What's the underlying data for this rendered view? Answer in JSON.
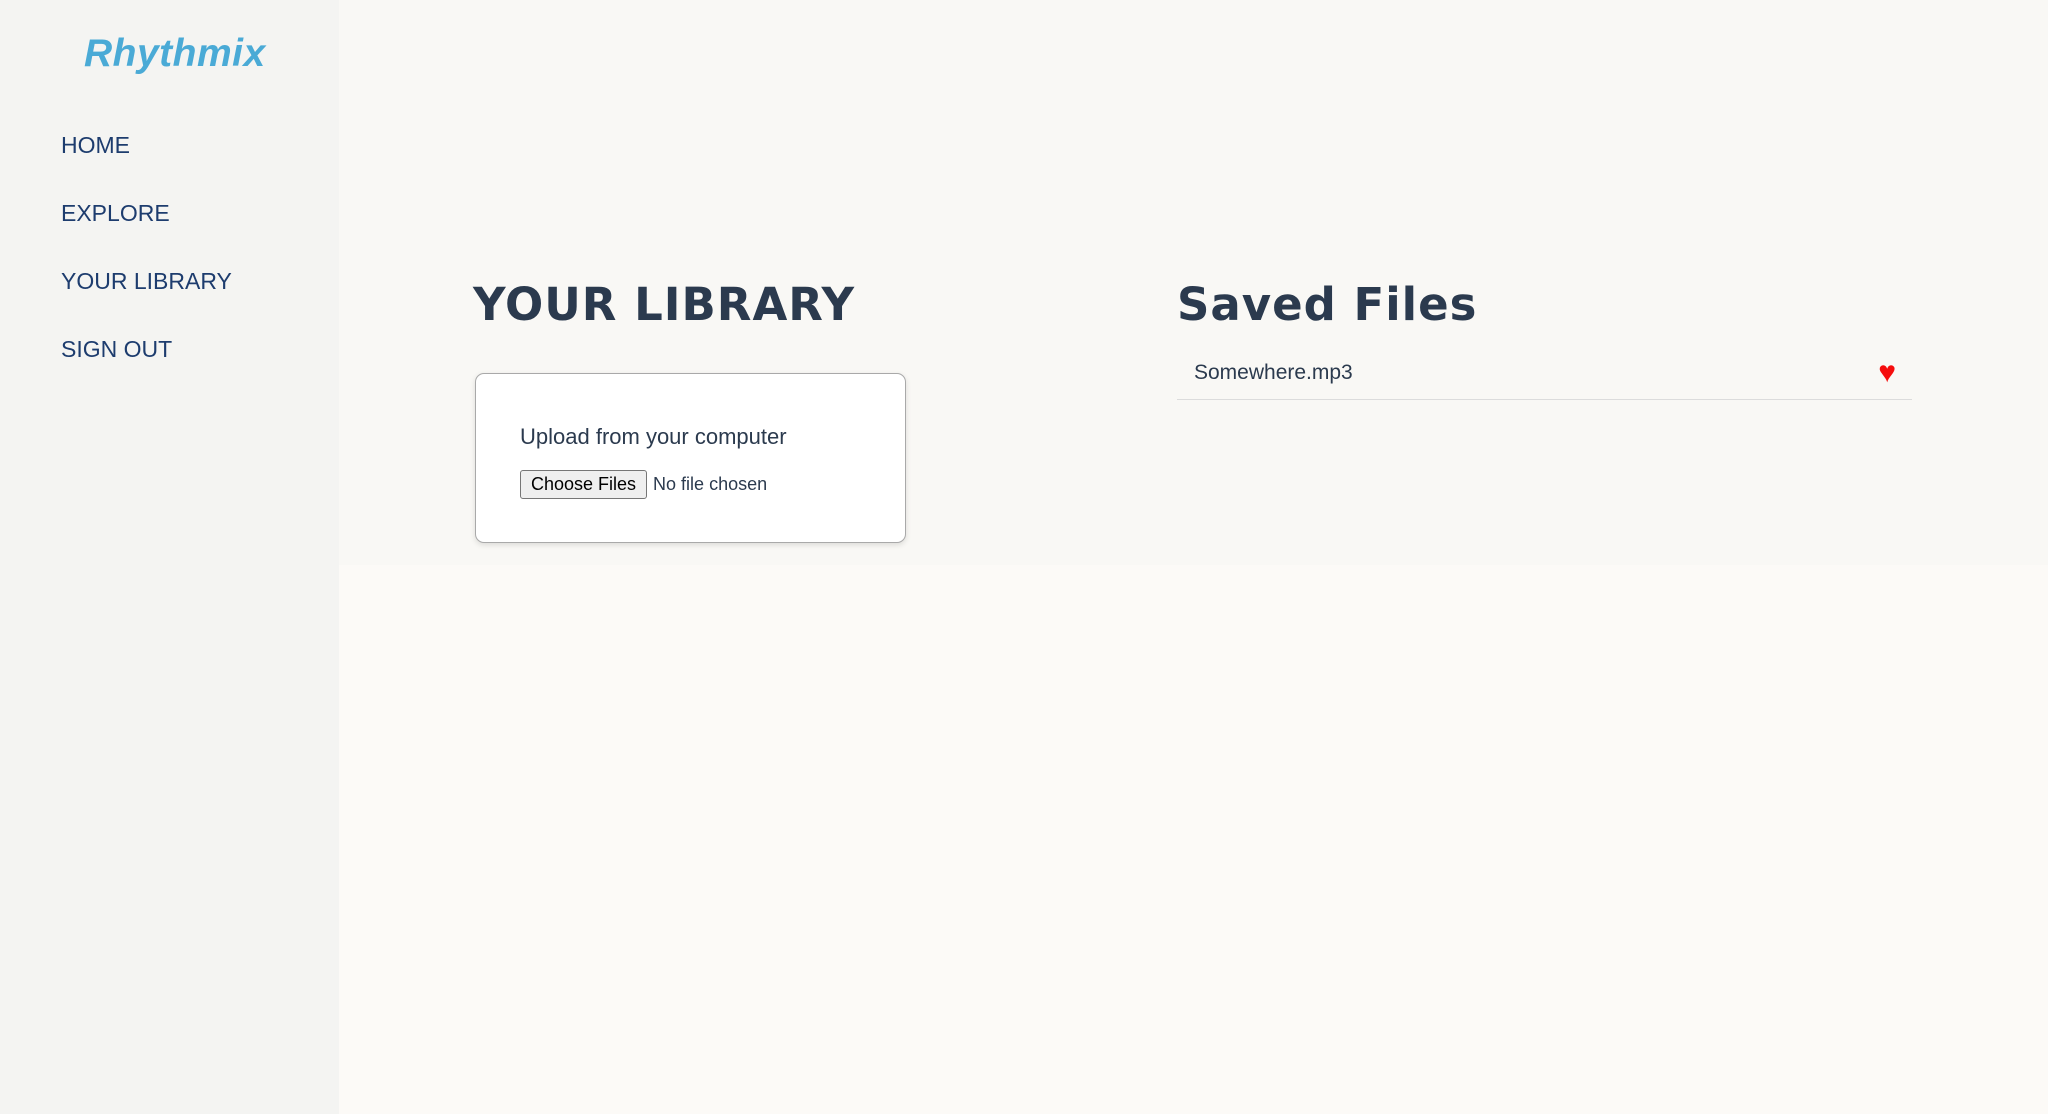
{
  "app": {
    "logo": "Rhythmix"
  },
  "sidebar": {
    "items": [
      {
        "label": "HOME"
      },
      {
        "label": "EXPLORE"
      },
      {
        "label": "YOUR LIBRARY"
      },
      {
        "label": "SIGN OUT"
      }
    ]
  },
  "library": {
    "title": "YOUR LIBRARY",
    "upload_label": "Upload from your computer",
    "choose_button": "Choose Files",
    "file_status": "No file chosen"
  },
  "saved": {
    "title": "Saved Files",
    "files": [
      {
        "name": "Somewhere.mp3",
        "icon": "heart-icon",
        "favorite": true
      }
    ]
  },
  "colors": {
    "accent": "#4aaad6",
    "nav_text": "#1d3c6e",
    "heading": "#2b3a4e",
    "heart": "#f50d0d"
  }
}
